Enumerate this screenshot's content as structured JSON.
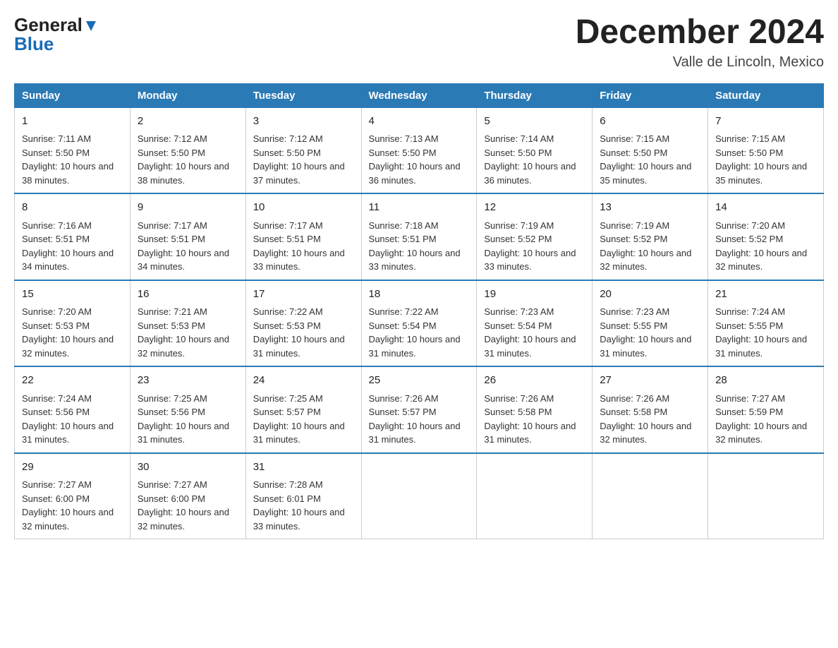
{
  "header": {
    "logo_general": "General",
    "logo_blue": "Blue",
    "title": "December 2024",
    "subtitle": "Valle de Lincoln, Mexico"
  },
  "days_of_week": [
    "Sunday",
    "Monday",
    "Tuesday",
    "Wednesday",
    "Thursday",
    "Friday",
    "Saturday"
  ],
  "weeks": [
    [
      {
        "day": "1",
        "sunrise": "7:11 AM",
        "sunset": "5:50 PM",
        "daylight": "10 hours and 38 minutes."
      },
      {
        "day": "2",
        "sunrise": "7:12 AM",
        "sunset": "5:50 PM",
        "daylight": "10 hours and 38 minutes."
      },
      {
        "day": "3",
        "sunrise": "7:12 AM",
        "sunset": "5:50 PM",
        "daylight": "10 hours and 37 minutes."
      },
      {
        "day": "4",
        "sunrise": "7:13 AM",
        "sunset": "5:50 PM",
        "daylight": "10 hours and 36 minutes."
      },
      {
        "day": "5",
        "sunrise": "7:14 AM",
        "sunset": "5:50 PM",
        "daylight": "10 hours and 36 minutes."
      },
      {
        "day": "6",
        "sunrise": "7:15 AM",
        "sunset": "5:50 PM",
        "daylight": "10 hours and 35 minutes."
      },
      {
        "day": "7",
        "sunrise": "7:15 AM",
        "sunset": "5:50 PM",
        "daylight": "10 hours and 35 minutes."
      }
    ],
    [
      {
        "day": "8",
        "sunrise": "7:16 AM",
        "sunset": "5:51 PM",
        "daylight": "10 hours and 34 minutes."
      },
      {
        "day": "9",
        "sunrise": "7:17 AM",
        "sunset": "5:51 PM",
        "daylight": "10 hours and 34 minutes."
      },
      {
        "day": "10",
        "sunrise": "7:17 AM",
        "sunset": "5:51 PM",
        "daylight": "10 hours and 33 minutes."
      },
      {
        "day": "11",
        "sunrise": "7:18 AM",
        "sunset": "5:51 PM",
        "daylight": "10 hours and 33 minutes."
      },
      {
        "day": "12",
        "sunrise": "7:19 AM",
        "sunset": "5:52 PM",
        "daylight": "10 hours and 33 minutes."
      },
      {
        "day": "13",
        "sunrise": "7:19 AM",
        "sunset": "5:52 PM",
        "daylight": "10 hours and 32 minutes."
      },
      {
        "day": "14",
        "sunrise": "7:20 AM",
        "sunset": "5:52 PM",
        "daylight": "10 hours and 32 minutes."
      }
    ],
    [
      {
        "day": "15",
        "sunrise": "7:20 AM",
        "sunset": "5:53 PM",
        "daylight": "10 hours and 32 minutes."
      },
      {
        "day": "16",
        "sunrise": "7:21 AM",
        "sunset": "5:53 PM",
        "daylight": "10 hours and 32 minutes."
      },
      {
        "day": "17",
        "sunrise": "7:22 AM",
        "sunset": "5:53 PM",
        "daylight": "10 hours and 31 minutes."
      },
      {
        "day": "18",
        "sunrise": "7:22 AM",
        "sunset": "5:54 PM",
        "daylight": "10 hours and 31 minutes."
      },
      {
        "day": "19",
        "sunrise": "7:23 AM",
        "sunset": "5:54 PM",
        "daylight": "10 hours and 31 minutes."
      },
      {
        "day": "20",
        "sunrise": "7:23 AM",
        "sunset": "5:55 PM",
        "daylight": "10 hours and 31 minutes."
      },
      {
        "day": "21",
        "sunrise": "7:24 AM",
        "sunset": "5:55 PM",
        "daylight": "10 hours and 31 minutes."
      }
    ],
    [
      {
        "day": "22",
        "sunrise": "7:24 AM",
        "sunset": "5:56 PM",
        "daylight": "10 hours and 31 minutes."
      },
      {
        "day": "23",
        "sunrise": "7:25 AM",
        "sunset": "5:56 PM",
        "daylight": "10 hours and 31 minutes."
      },
      {
        "day": "24",
        "sunrise": "7:25 AM",
        "sunset": "5:57 PM",
        "daylight": "10 hours and 31 minutes."
      },
      {
        "day": "25",
        "sunrise": "7:26 AM",
        "sunset": "5:57 PM",
        "daylight": "10 hours and 31 minutes."
      },
      {
        "day": "26",
        "sunrise": "7:26 AM",
        "sunset": "5:58 PM",
        "daylight": "10 hours and 31 minutes."
      },
      {
        "day": "27",
        "sunrise": "7:26 AM",
        "sunset": "5:58 PM",
        "daylight": "10 hours and 32 minutes."
      },
      {
        "day": "28",
        "sunrise": "7:27 AM",
        "sunset": "5:59 PM",
        "daylight": "10 hours and 32 minutes."
      }
    ],
    [
      {
        "day": "29",
        "sunrise": "7:27 AM",
        "sunset": "6:00 PM",
        "daylight": "10 hours and 32 minutes."
      },
      {
        "day": "30",
        "sunrise": "7:27 AM",
        "sunset": "6:00 PM",
        "daylight": "10 hours and 32 minutes."
      },
      {
        "day": "31",
        "sunrise": "7:28 AM",
        "sunset": "6:01 PM",
        "daylight": "10 hours and 33 minutes."
      },
      null,
      null,
      null,
      null
    ]
  ],
  "labels": {
    "sunrise": "Sunrise:",
    "sunset": "Sunset:",
    "daylight": "Daylight:"
  }
}
